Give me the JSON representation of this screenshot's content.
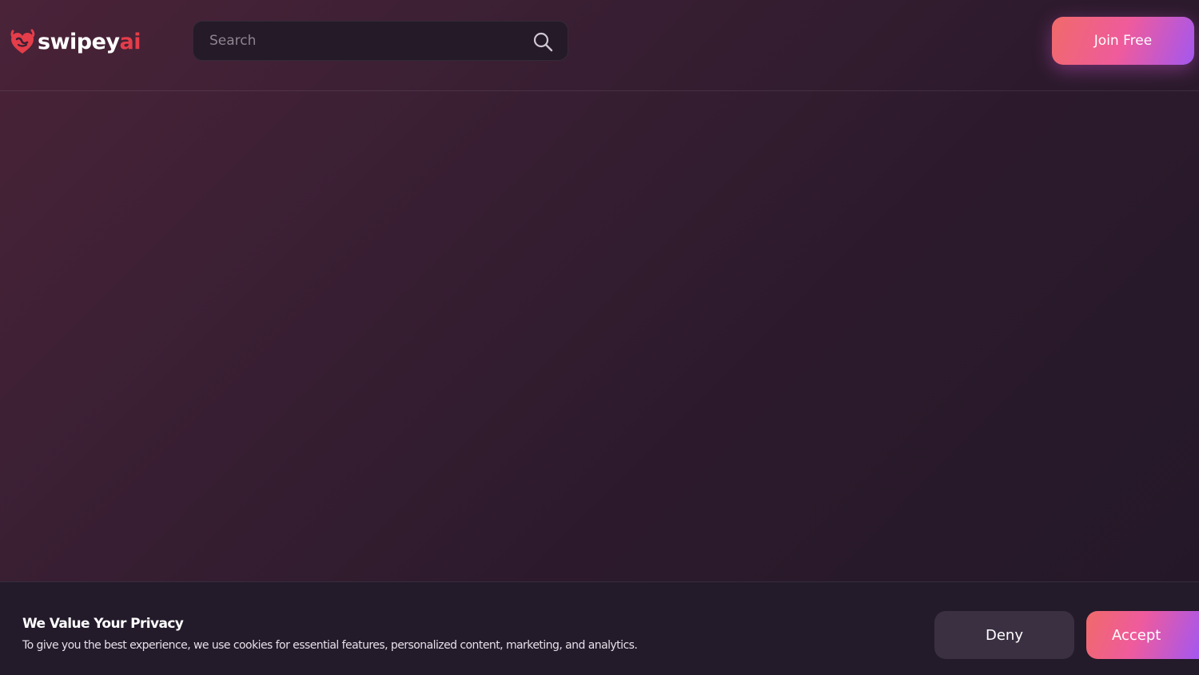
{
  "header": {
    "logo": {
      "text_part_1": "swipey",
      "text_part_2": "ai",
      "icon": "devil-heart-icon",
      "brand_color": "#e53d4a"
    },
    "search": {
      "placeholder": "Search",
      "value": "",
      "icon": "search-icon"
    },
    "join_label": "Join Free"
  },
  "cookie_banner": {
    "title": "We Value Your Privacy",
    "text": "To give you the best experience, we use cookies for essential features, personalized content, marketing, and analytics.",
    "deny_label": "Deny",
    "accept_label": "Accept"
  },
  "colors": {
    "accent_gradient_start": "#f06a6a",
    "accent_gradient_mid": "#ef5b9c",
    "accent_gradient_end": "#a357f0",
    "deny_button": "#3b3042",
    "banner_background": "#231a2a"
  }
}
